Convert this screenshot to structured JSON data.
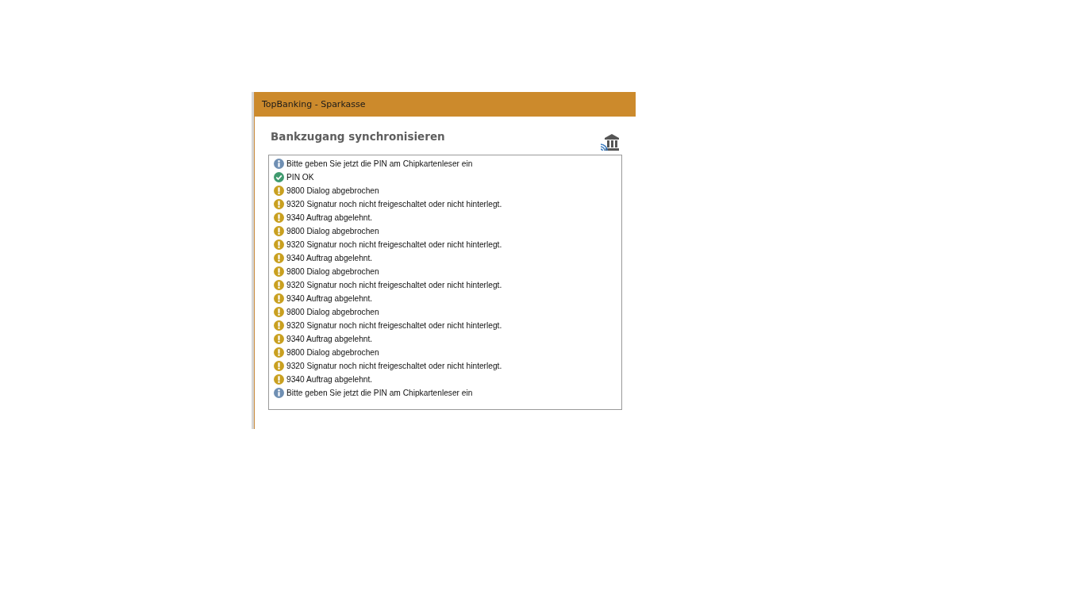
{
  "window": {
    "title": "TopBanking - Sparkasse"
  },
  "heading": "Bankzugang synchronisieren",
  "messages": [
    {
      "kind": "info",
      "text": "Bitte geben Sie jetzt die PIN am Chipkartenleser ein"
    },
    {
      "kind": "ok",
      "text": "PIN OK"
    },
    {
      "kind": "warning",
      "text": "9800 Dialog abgebrochen"
    },
    {
      "kind": "warning",
      "text": "9320 Signatur noch nicht freigeschaltet oder nicht hinterlegt."
    },
    {
      "kind": "warning",
      "text": "9340 Auftrag abgelehnt."
    },
    {
      "kind": "warning",
      "text": "9800 Dialog abgebrochen"
    },
    {
      "kind": "warning",
      "text": "9320 Signatur noch nicht freigeschaltet oder nicht hinterlegt."
    },
    {
      "kind": "warning",
      "text": "9340 Auftrag abgelehnt."
    },
    {
      "kind": "warning",
      "text": "9800 Dialog abgebrochen"
    },
    {
      "kind": "warning",
      "text": "9320 Signatur noch nicht freigeschaltet oder nicht hinterlegt."
    },
    {
      "kind": "warning",
      "text": "9340 Auftrag abgelehnt."
    },
    {
      "kind": "warning",
      "text": "9800 Dialog abgebrochen"
    },
    {
      "kind": "warning",
      "text": "9320 Signatur noch nicht freigeschaltet oder nicht hinterlegt."
    },
    {
      "kind": "warning",
      "text": "9340 Auftrag abgelehnt."
    },
    {
      "kind": "warning",
      "text": "9800 Dialog abgebrochen"
    },
    {
      "kind": "warning",
      "text": "9320 Signatur noch nicht freigeschaltet oder nicht hinterlegt."
    },
    {
      "kind": "warning",
      "text": "9340 Auftrag abgelehnt."
    },
    {
      "kind": "info",
      "text": "Bitte geben Sie jetzt die PIN am Chipkartenleser ein"
    }
  ]
}
